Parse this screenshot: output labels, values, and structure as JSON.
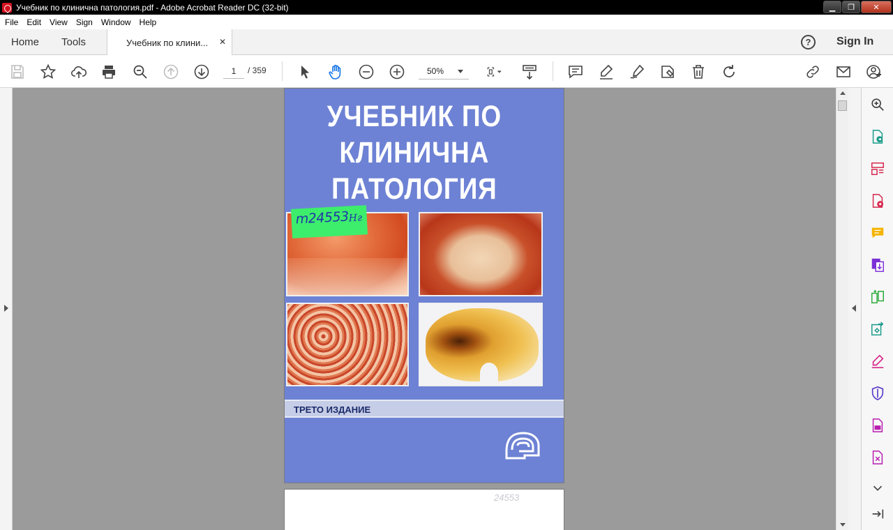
{
  "window": {
    "title": "Учебник по клинична патология.pdf - Adobe Acrobat Reader DC (32-bit)",
    "minimize": "▁",
    "restore": "❐",
    "close": "✕"
  },
  "menu": {
    "file": "File",
    "edit": "Edit",
    "view": "View",
    "sign": "Sign",
    "window": "Window",
    "help": "Help"
  },
  "tabs": {
    "home": "Home",
    "tools": "Tools",
    "doc": "Учебник по клини...",
    "close": "✕"
  },
  "header": {
    "help": "?",
    "sign_in": "Sign In"
  },
  "toolbar": {
    "page_current": "1",
    "page_total": "/  359",
    "zoom": "50%"
  },
  "document": {
    "title_lines": [
      "УЧЕБНИК ПО",
      "КЛИНИЧНА",
      "ПАТОЛОГИЯ"
    ],
    "stamp_number": "m24553",
    "stamp_suffix": "Нг",
    "edition": "ТРЕТО ИЗДАНИЕ",
    "page2_ghost": "24553"
  },
  "colors": {
    "accent": "#1473e6",
    "cover_blue": "#6d82d4",
    "stamp_green": "#3dee6c",
    "tool_purple": "#7b2fd6"
  }
}
